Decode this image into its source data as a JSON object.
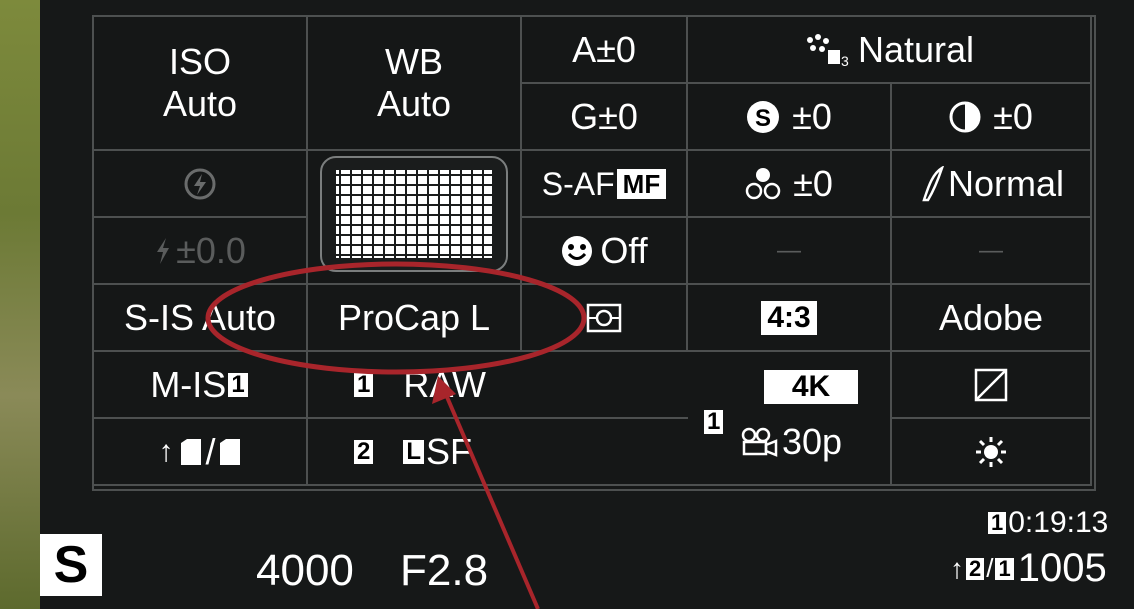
{
  "app": "Olympus Super Control Panel",
  "colors": {
    "background": "#161818",
    "grid_line": "#4d5050",
    "text": "#ffffff",
    "dim_text": "#5a5c5c",
    "annotation": "#a8252b",
    "tile_bg": "#3a3d3d"
  },
  "grid": {
    "iso": {
      "label": "ISO",
      "value": "Auto"
    },
    "wb": {
      "label": "WB",
      "value": "Auto"
    },
    "wb_a": "A±0",
    "wb_g": "G±0",
    "picture_mode": {
      "icon": "picture-mode-icon",
      "sub": "3",
      "label": "Natural"
    },
    "saturation": "±0",
    "contrast": "±0",
    "flash_mode": {
      "icon": "flash-icon"
    },
    "af_mode": {
      "prefix": "S-AF",
      "badge": "MF"
    },
    "gradation": "±0",
    "sharpness": "Normal",
    "flash_comp": "±0.0",
    "face_priority": {
      "icon": "face-icon",
      "label": "Off"
    },
    "dash_1": "—",
    "dash_2": "—",
    "image_stabilizer": "S-IS Auto",
    "drive_mode": "ProCap L",
    "metering": {
      "icon": "metering-icon"
    },
    "aspect": "4:3",
    "color_space": "Adobe",
    "movie_is": {
      "label": "M-IS",
      "badge": "1"
    },
    "card1_quality": {
      "badge": "1",
      "label": "RAW"
    },
    "video_card": {
      "badge": "1",
      "res": "4K",
      "fps": "30p"
    },
    "shading": {
      "icon": "shading-icon"
    },
    "card_save": {
      "arrow": "↑",
      "sep": "/"
    },
    "card2_quality": {
      "badge": "2",
      "size_badge": "L",
      "label": "SF"
    },
    "wb_custom": {
      "icon": "sun-icon"
    }
  },
  "bottom": {
    "mode": "S",
    "shutter": "4000",
    "aperture": "F2.8",
    "record_time": "0:19:13",
    "record_card": "1",
    "shots_remaining": "1005",
    "card_save_arrow": "↑",
    "card_save_badge1": "2",
    "card_save_badge2": "1",
    "card_save_sep": "/"
  },
  "annotation": {
    "shape": "ellipse",
    "target": "ProCap L",
    "color": "#a8252b"
  }
}
